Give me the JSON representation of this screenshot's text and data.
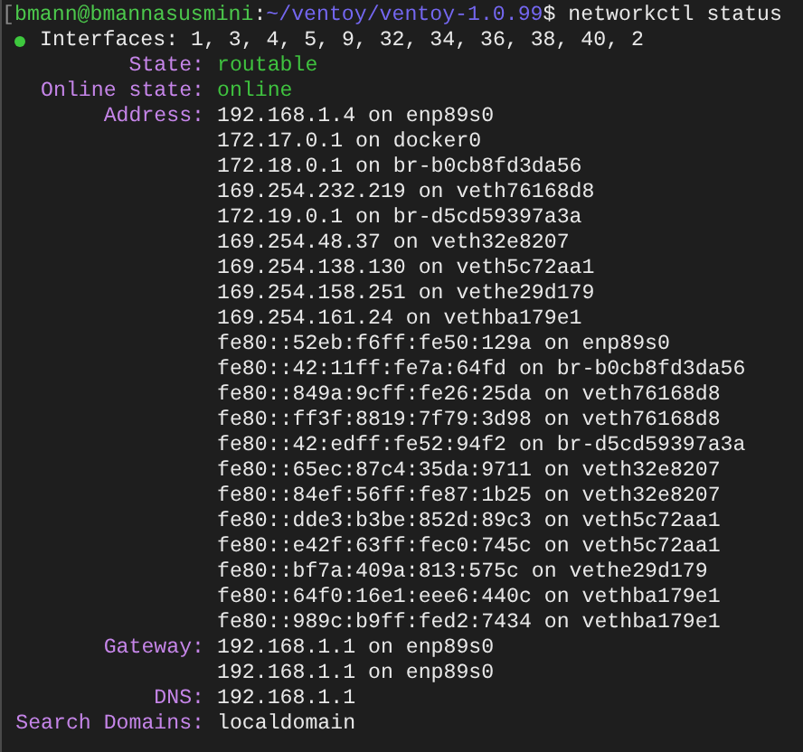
{
  "prompt": {
    "bracket": "[",
    "user_host": "bmann@bmannasusmini",
    "separator": ":",
    "path": "~/ventoy/ventoy-1.0.99",
    "symbol": "$",
    "command": " networkctl status"
  },
  "summary": {
    "color": "#3ec83e",
    "text": "Interfaces: 1, 3, 4, 5, 9, 32, 34, 36, 38, 40, 2"
  },
  "fields": [
    {
      "label": "State:",
      "kind": "status",
      "values": [
        "routable"
      ]
    },
    {
      "label": "Online state:",
      "kind": "status",
      "values": [
        "online"
      ]
    },
    {
      "label": "Address:",
      "kind": "plain",
      "values": [
        "192.168.1.4 on enp89s0",
        "172.17.0.1 on docker0",
        "172.18.0.1 on br-b0cb8fd3da56",
        "169.254.232.219 on veth76168d8",
        "172.19.0.1 on br-d5cd59397a3a",
        "169.254.48.37 on veth32e8207",
        "169.254.138.130 on veth5c72aa1",
        "169.254.158.251 on vethe29d179",
        "169.254.161.24 on vethba179e1",
        "fe80::52eb:f6ff:fe50:129a on enp89s0",
        "fe80::42:11ff:fe7a:64fd on br-b0cb8fd3da56",
        "fe80::849a:9cff:fe26:25da on veth76168d8",
        "fe80::ff3f:8819:7f79:3d98 on veth76168d8",
        "fe80::42:edff:fe52:94f2 on br-d5cd59397a3a",
        "fe80::65ec:87c4:35da:9711 on veth32e8207",
        "fe80::84ef:56ff:fe87:1b25 on veth32e8207",
        "fe80::dde3:b3be:852d:89c3 on veth5c72aa1",
        "fe80::e42f:63ff:fec0:745c on veth5c72aa1",
        "fe80::bf7a:409a:813:575c on vethe29d179",
        "fe80::64f0:16e1:eee6:440c on vethba179e1",
        "fe80::989c:b9ff:fed2:7434 on vethba179e1"
      ]
    },
    {
      "label": "Gateway:",
      "kind": "plain",
      "values": [
        "192.168.1.1 on enp89s0",
        "192.168.1.1 on enp89s0"
      ]
    },
    {
      "label": "DNS:",
      "kind": "plain",
      "values": [
        "192.168.1.1"
      ]
    },
    {
      "label": "Search Domains:",
      "kind": "plain",
      "values": [
        "localdomain"
      ]
    }
  ]
}
